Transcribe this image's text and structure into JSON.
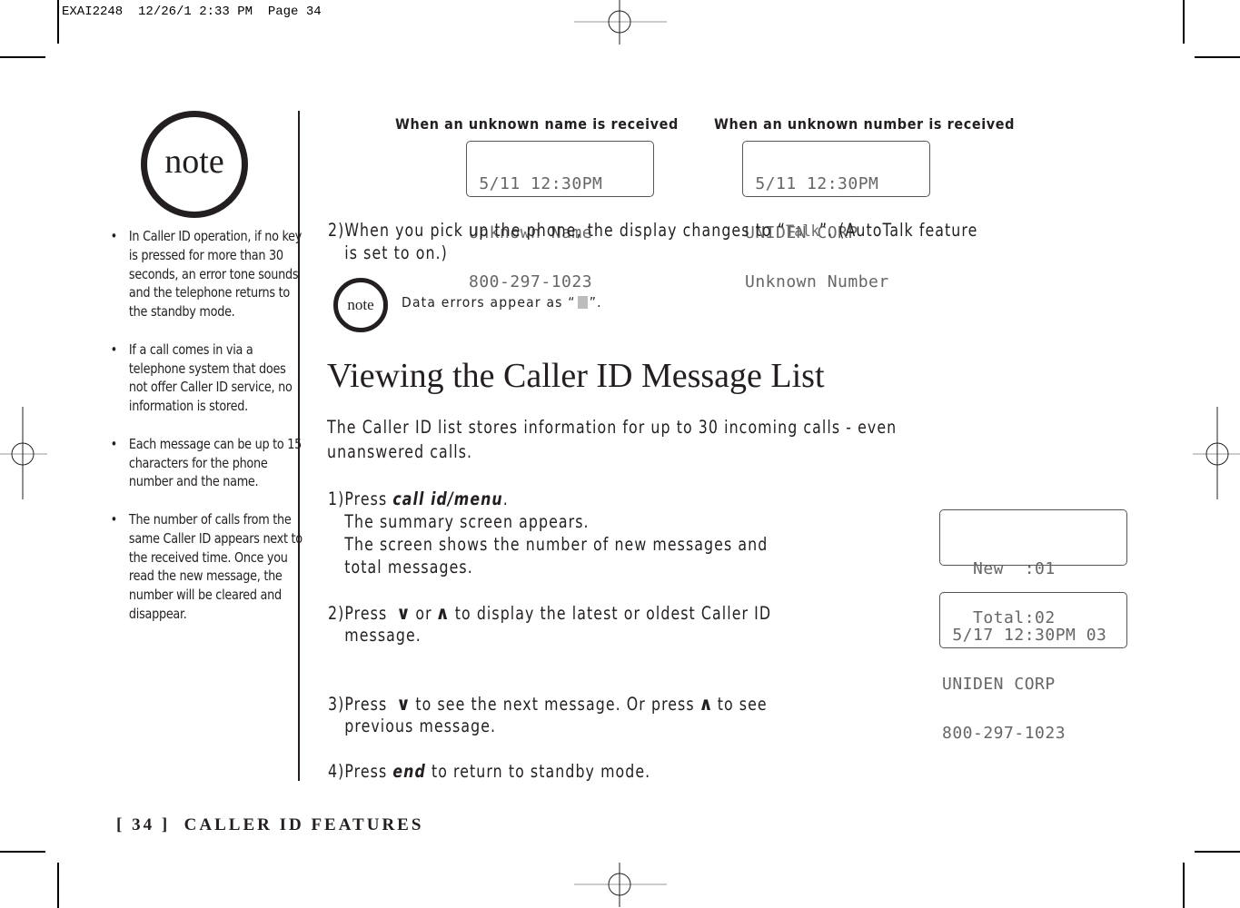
{
  "slug": "EXAI2248  12/26/1 2:33 PM  Page 34",
  "sidebar": {
    "note_label": "note",
    "bullets": [
      "In Caller ID operation, if no key is pressed for more than 30 seconds, an error tone sounds and the telephone returns to the standby mode.",
      "If a call comes in via a telephone system that does not offer Caller ID service, no information is stored.",
      "Each message can be up to 15 characters for the phone number and the name.",
      "The number of calls from the same Caller ID appears next to the received time. Once you read the new message, the number will be cleared and disappear."
    ]
  },
  "captions": {
    "unknown_name": "When an unknown name is received",
    "unknown_number": "When an unknown number is received"
  },
  "displays": {
    "unknown_name": [
      " 5/11 12:30PM",
      "Unknown Name",
      "800-297-1023"
    ],
    "unknown_number": [
      " 5/11 12:30PM",
      "UNIDEN CORP",
      "Unknown Number"
    ],
    "summary": [
      "   New  :01",
      "   Total:02"
    ],
    "message": [
      " 5/17 12:30PM 03",
      "UNIDEN CORP",
      "800-297-1023"
    ]
  },
  "step2_talk": {
    "prefix": "2)When you pick up the phone, the display changes to “",
    "talk_word": "Talk",
    "suffix": "”. (AutoTalk feature",
    "line2": "   is set to on.)"
  },
  "note_inline": {
    "label": "note",
    "text_before": "Data errors appear as “",
    "text_after": "”."
  },
  "section": {
    "title": "Viewing the Caller ID Message List",
    "intro_line1": "The Caller ID list stores information for up to 30 incoming calls - even",
    "intro_line2": "unanswered calls.",
    "steps": {
      "s1_prefix": "1)Press ",
      "s1_key": "call id/menu",
      "s1_suffix": ".",
      "s1_line2": "   The summary screen appears.",
      "s1_line3": "   The screen shows the number of new messages and",
      "s1_line4": "   total messages.",
      "s2_prefix": "2)Press ",
      "s2_mid": "or",
      "s2_suffix": "to display the latest or oldest Caller ID",
      "s2_line2": "   message.",
      "s3_prefix": "3)Press ",
      "s3_mid": "to see the next message. Or press",
      "s3_suffix": "to see",
      "s3_line2": "   previous message.",
      "s4_prefix": "4)Press ",
      "s4_key": "end",
      "s4_suffix": " to return to standby mode."
    },
    "arrow_down": "∨",
    "arrow_up": "∧"
  },
  "footer": {
    "page": "[ 34 ]",
    "section": "CALLER ID FEATURES"
  }
}
